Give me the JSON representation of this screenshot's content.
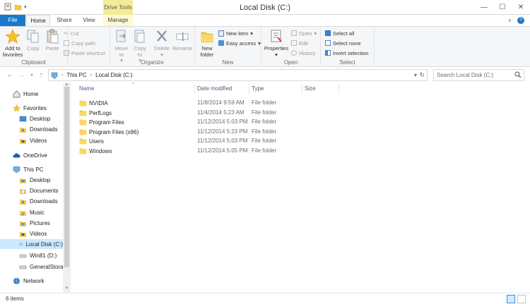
{
  "window": {
    "title": "Local Disk (C:)",
    "context_tab_group": "Drive Tools"
  },
  "tabs": [
    {
      "label": "File",
      "active": false
    },
    {
      "label": "Home",
      "active": true
    },
    {
      "label": "Share",
      "active": false
    },
    {
      "label": "View",
      "active": false
    },
    {
      "label": "Manage",
      "active": false
    }
  ],
  "ribbon": {
    "clipboard": {
      "label": "Clipboard",
      "add_favorites": "Add to favorites",
      "copy": "Copy",
      "paste": "Paste",
      "cut": "Cut",
      "copy_path": "Copy path",
      "paste_shortcut": "Paste shortcut"
    },
    "organize": {
      "label": "Organize",
      "move_to": "Move to",
      "copy_to": "Copy to",
      "delete": "Delete",
      "rename": "Rename"
    },
    "new": {
      "label": "New",
      "new_folder": "New folder",
      "new_item": "New item",
      "easy_access": "Easy access"
    },
    "open": {
      "label": "Open",
      "properties": "Properties",
      "open": "Open",
      "edit": "Edit",
      "history": "History"
    },
    "select": {
      "label": "Select",
      "select_all": "Select all",
      "select_none": "Select none",
      "invert_selection": "Invert selection"
    }
  },
  "address": {
    "crumbs": [
      "This PC",
      "Local Disk (C:)"
    ],
    "search_placeholder": "Search Local Disk (C:)"
  },
  "nav": {
    "home": "Home",
    "favorites": "Favorites",
    "fav_desktop": "Desktop",
    "fav_downloads": "Downloads",
    "fav_videos": "Videos",
    "onedrive": "OneDrive",
    "thispc": "This PC",
    "pc_desktop": "Desktop",
    "pc_documents": "Documents",
    "pc_downloads": "Downloads",
    "pc_music": "Music",
    "pc_pictures": "Pictures",
    "pc_videos": "Videos",
    "local_disk": "Local Disk (C:)",
    "win81": "Win81 (D:)",
    "general_storage": "GeneralStorag",
    "network": "Network"
  },
  "columns": {
    "name": "Name",
    "date": "Date modified",
    "type": "Type",
    "size": "Size"
  },
  "files": [
    {
      "name": "NVIDIA",
      "date": "11/8/2014 9:59 AM",
      "type": "File folder"
    },
    {
      "name": "PerfLogs",
      "date": "11/4/2014 5:23 AM",
      "type": "File folder"
    },
    {
      "name": "Program Files",
      "date": "11/12/2014 5:03 PM",
      "type": "File folder"
    },
    {
      "name": "Program Files (x86)",
      "date": "11/12/2014 5:23 PM",
      "type": "File folder"
    },
    {
      "name": "Users",
      "date": "11/12/2014 5:03 PM",
      "type": "File folder"
    },
    {
      "name": "Windows",
      "date": "11/12/2014 5:05 PM",
      "type": "File folder"
    }
  ],
  "status": {
    "item_count": "6 items"
  },
  "colors": {
    "file_tab": "#1979ca",
    "context_tab": "#f3eb96",
    "selected": "#cce8ff",
    "folder": "#f5c94b"
  }
}
